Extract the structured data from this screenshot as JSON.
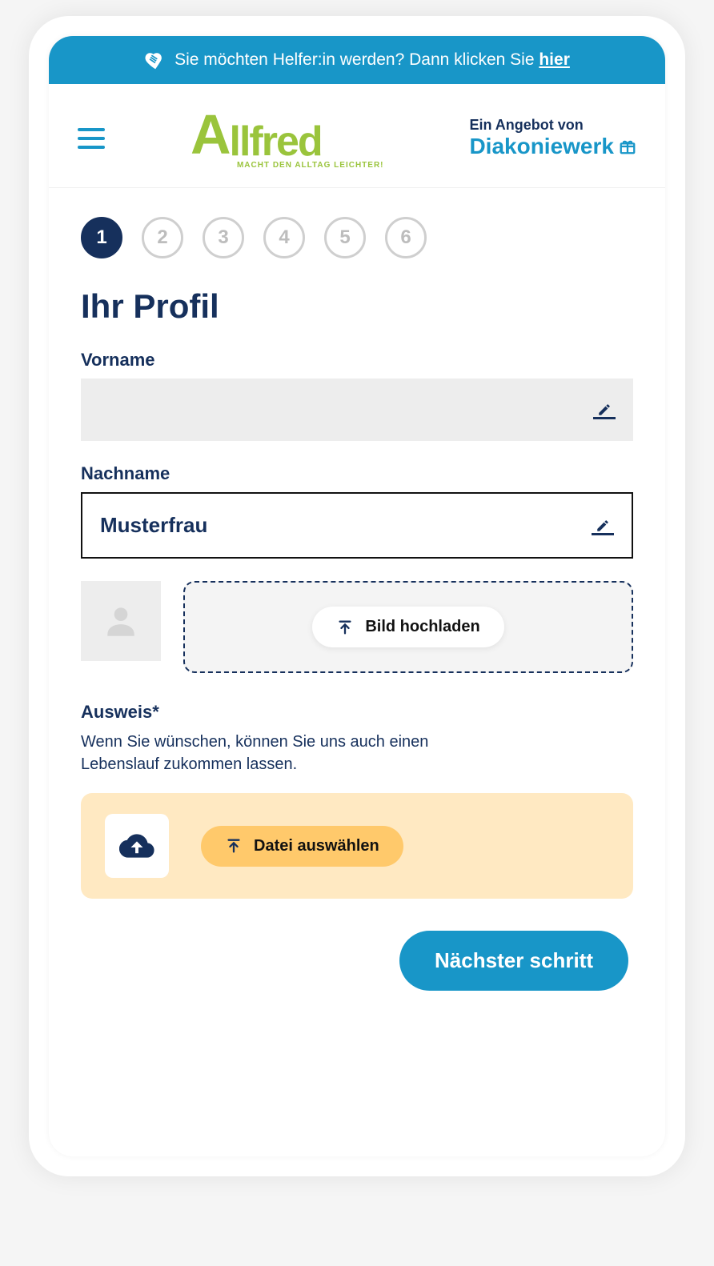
{
  "banner": {
    "text_prefix": "Sie möchten Helfer:in werden? Dann klicken Sie ",
    "link_label": "hier"
  },
  "header": {
    "logo_text": "llfred",
    "logo_slogan": "MACHT DEN ALLTAG LEICHTER!",
    "partner_top": "Ein Angebot von",
    "partner_bottom": "Diakoniewerk"
  },
  "stepper": {
    "steps": [
      "1",
      "2",
      "3",
      "4",
      "5",
      "6"
    ],
    "active_index": 0
  },
  "page": {
    "title": "Ihr Profil"
  },
  "form": {
    "vorname": {
      "label": "Vorname",
      "value": ""
    },
    "nachname": {
      "label": "Nachname",
      "value": "Musterfrau"
    },
    "image_upload": {
      "button_label": "Bild hochladen"
    },
    "ausweis": {
      "label": "Ausweis*",
      "description": "Wenn Sie wünschen, können Sie uns auch einen Lebenslauf zukommen lassen.",
      "button_label": "Datei auswählen"
    }
  },
  "actions": {
    "next": "Nächster schritt"
  }
}
